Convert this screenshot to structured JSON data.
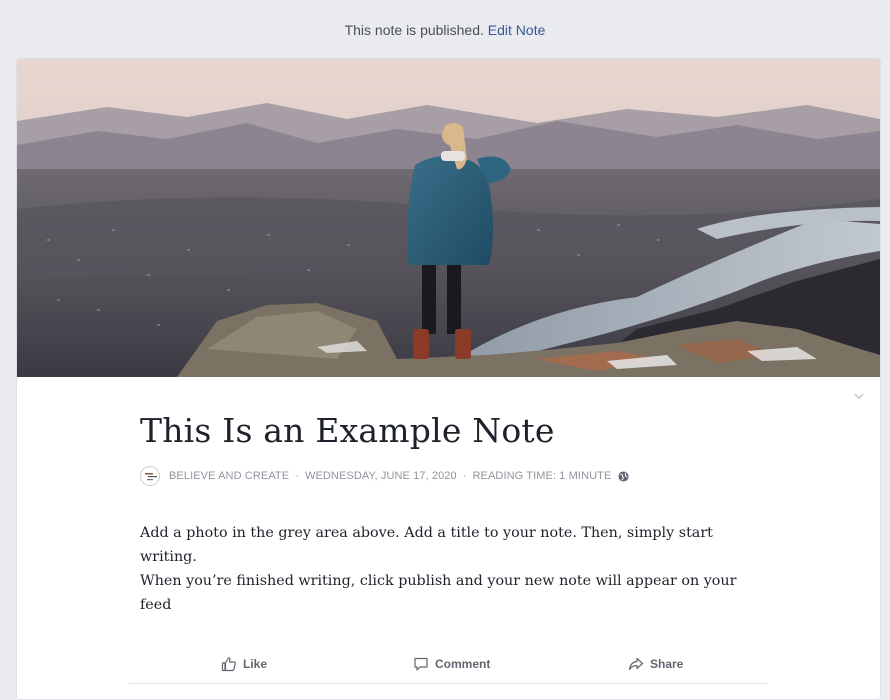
{
  "status": {
    "message": "This note is published.",
    "edit_link": "Edit Note"
  },
  "note": {
    "title": "This Is an Example Note",
    "author": "BELIEVE AND CREATE",
    "date": "WEDNESDAY, JUNE 17, 2020",
    "reading_time": "READING TIME: 1 MINUTE",
    "privacy_icon": "globe-icon",
    "body_lines": [
      "Add a photo in the grey area above.  Add a title to your note.  Then, simply start writing.",
      "When you’re finished writing, click publish and your new note will appear on your feed"
    ]
  },
  "actions": {
    "like": "Like",
    "comment": "Comment",
    "share": "Share"
  },
  "colors": {
    "page_bg": "#e9ebee",
    "link": "#385898",
    "meta_text": "#90949c",
    "action_text": "#606770"
  }
}
